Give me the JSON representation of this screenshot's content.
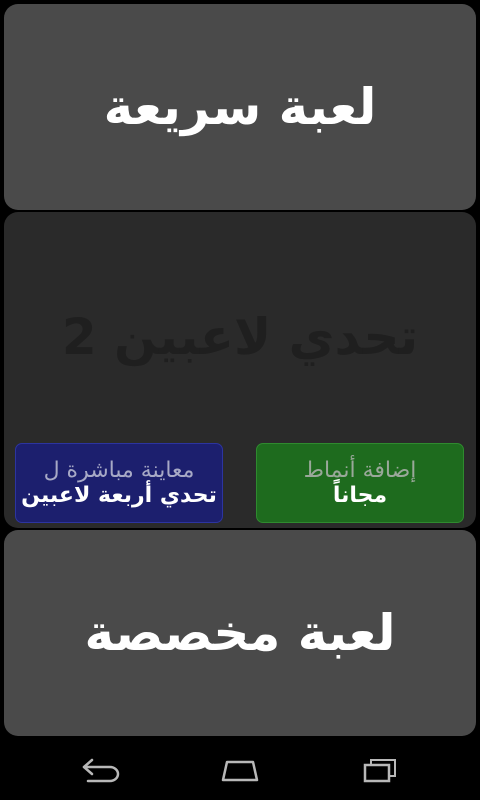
{
  "buttons": {
    "quick_game": "لعبة سريعة",
    "challenge_title": "تحدي لاعبين 2",
    "add_modes_line1": "إضافة أنماط",
    "add_modes_line2": "مجاناً",
    "preview_line1": "معاينة مباشرة ل",
    "preview_line2": "تحدي أربعة لاعبين",
    "custom_game": "لعبة مخصصة"
  },
  "nav": {
    "back_icon": "back-icon",
    "home_icon": "home-icon",
    "recents_icon": "recents-icon"
  },
  "colors": {
    "panel_gray": "#4a4a4a",
    "disabled_panel": "#2a2a2a",
    "green_button": "#1e6b1e",
    "blue_button": "#1c1f6e"
  }
}
